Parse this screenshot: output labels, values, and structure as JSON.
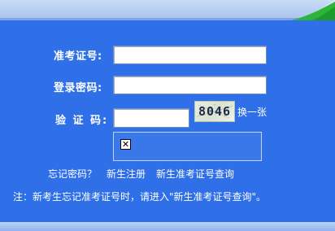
{
  "form": {
    "ticket_label": "准考证号:",
    "password_label": "登录密码:",
    "captcha_label": "验 证 码:",
    "ticket_value": "",
    "password_value": "",
    "captcha_value": "",
    "captcha_image_text": "8046",
    "refresh_label": "换一张"
  },
  "links": {
    "forgot_password": "忘记密码？",
    "new_student_register": "新生注册",
    "new_student_query": "新生准考证号查询"
  },
  "note": "注：新考生忘记准考证号时，请进入\"新生准考证号查询\"。",
  "colors": {
    "panel_bg": "#2f6fe8",
    "band_light": "#c9dcf7",
    "accent_green": "#2db53a",
    "text": "#ffffff"
  }
}
